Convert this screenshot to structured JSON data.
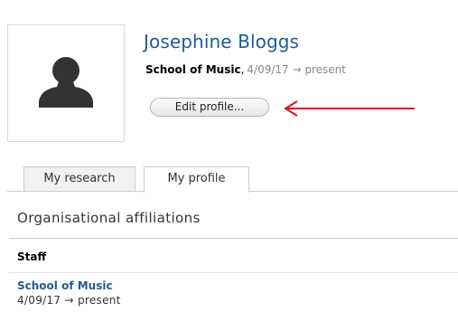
{
  "profile": {
    "name": "Josephine Bloggs",
    "school": "School of Music",
    "comma": ",",
    "dates": "4/09/17 → present",
    "edit_button": "Edit profile..."
  },
  "tabs": [
    {
      "label": "My research",
      "active": false
    },
    {
      "label": "My profile",
      "active": true
    }
  ],
  "affiliations": {
    "heading": "Organisational affiliations",
    "group": "Staff",
    "items": [
      {
        "school": "School of Music",
        "dates": "4/09/17 → present"
      }
    ]
  },
  "colors": {
    "link": "#1f5c99",
    "annotation_arrow": "#e0101a",
    "avatar_silhouette": "#333333"
  },
  "icons": {
    "avatar": "person-silhouette-icon",
    "annotation": "red-arrow-icon"
  }
}
